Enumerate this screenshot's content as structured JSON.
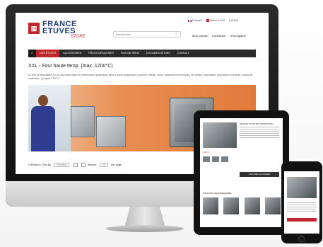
{
  "site": {
    "logo_line1": "FRANCE",
    "logo_line2": "ETUVES",
    "logo_line3": "STORE",
    "search_placeholder": "Rechercher",
    "lang": "Français",
    "cart": "Panier 0,00 €",
    "currency": "€ (EUR)",
    "account": "Mon compte",
    "login": "Connexion",
    "register": "S'enregistrer"
  },
  "nav": {
    "items": [
      {
        "label": "NOS ÉTUVES"
      },
      {
        "label": "ACCESSOIRES"
      },
      {
        "label": "PIÈCES DÉTACHÉES"
      },
      {
        "label": "FINS DE SÉRIE"
      },
      {
        "label": "DOCUMENTATIONS"
      },
      {
        "label": "CONTACT"
      }
    ]
  },
  "page": {
    "title": "XXL - Four haute temp. (max. 1200°C)",
    "description": "Le four de laboratoire XXL16 est dédié dans de nombreuses applications liées à haute température (cuisson, frittage, recuit, traitements thermiques, de métaux, calcination, préparation d'analyse, essais de matériaux...) jusqu'à 1200°C."
  },
  "listing": {
    "count": "0 article(s)",
    "sort_label": "Sort By",
    "sort_value": "Position",
    "show_label": "Afficher",
    "show_value": "20",
    "per_page": "par page"
  },
  "tablet": {
    "title": "MOUFLE FOUR DE CONVECTION",
    "price": "0,00 €",
    "button": "AJOUTER AU PANIER",
    "section": "PRODUITS RECOMMANDÉS"
  },
  "colors": {
    "brand_red": "#c0272d",
    "brand_blue": "#1f3d7a",
    "nav_dark": "#2b2b2b"
  }
}
